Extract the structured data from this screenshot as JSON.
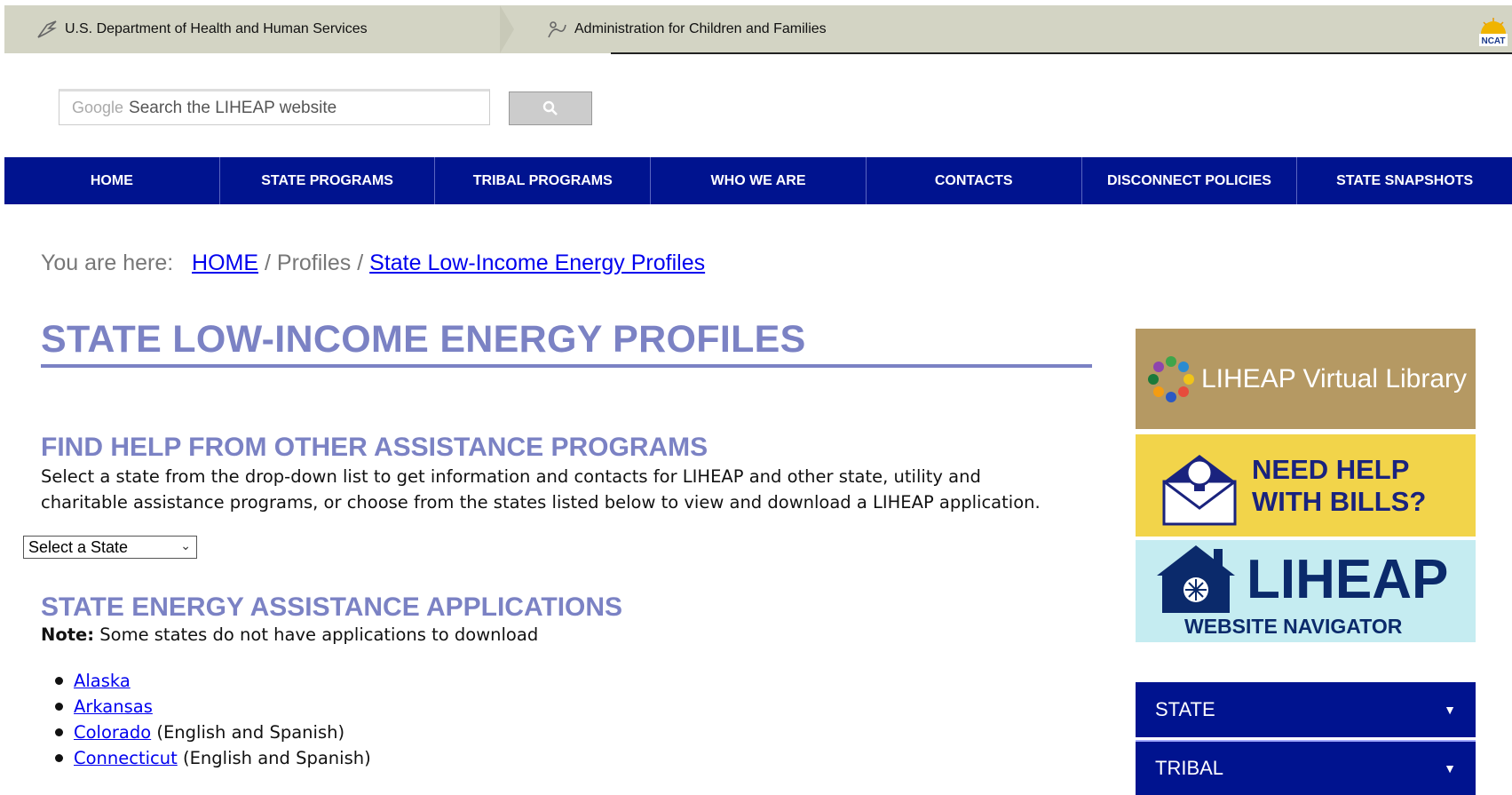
{
  "topbar": {
    "hhs": "U.S. Department of Health and Human Services",
    "acf": "Administration for Children and Families",
    "ncat": "NCAT"
  },
  "search": {
    "google_label": "Google",
    "placeholder": "Search the LIHEAP website"
  },
  "nav": [
    {
      "label": "HOME"
    },
    {
      "label": "STATE PROGRAMS"
    },
    {
      "label": "TRIBAL PROGRAMS"
    },
    {
      "label": "WHO WE ARE"
    },
    {
      "label": "CONTACTS"
    },
    {
      "label": "DISCONNECT POLICIES"
    },
    {
      "label": "STATE SNAPSHOTS"
    }
  ],
  "breadcrumb": {
    "prefix": "You are here:",
    "home": "HOME",
    "sep1": "/",
    "profiles": "Profiles",
    "sep2": "/",
    "current": "State Low-Income Energy Profiles"
  },
  "page": {
    "title": "STATE LOW-INCOME ENERGY PROFILES",
    "help_heading": "FIND HELP FROM OTHER ASSISTANCE PROGRAMS",
    "help_text": "Select a state from the drop-down list to get information and contacts for LIHEAP and other state, utility and charitable assistance programs, or choose from the states listed below to view and download a LIHEAP application.",
    "select_value": "Select a State",
    "apps_heading": "STATE ENERGY ASSISTANCE APPLICATIONS",
    "note_label": "Note:",
    "note_text": "Some states do not have applications to download",
    "states": [
      {
        "name": "Alaska",
        "suffix": ""
      },
      {
        "name": "Arkansas",
        "suffix": ""
      },
      {
        "name": "Colorado",
        "suffix": "(English and Spanish)"
      },
      {
        "name": "Connecticut",
        "suffix": "(English and Spanish)"
      }
    ]
  },
  "sidebar": {
    "virtual_library": "LIHEAP Virtual Library",
    "bills_line1": "NEED HELP",
    "bills_line2": "WITH BILLS?",
    "navigator_big": "LIHEAP",
    "navigator_small": "WEBSITE NAVIGATOR",
    "accordion": [
      {
        "label": "STATE"
      },
      {
        "label": "TRIBAL"
      }
    ]
  },
  "colors": {
    "nav_bg": "#00138f",
    "heading": "#7b82c4",
    "topbar": "#d3d4c4"
  }
}
